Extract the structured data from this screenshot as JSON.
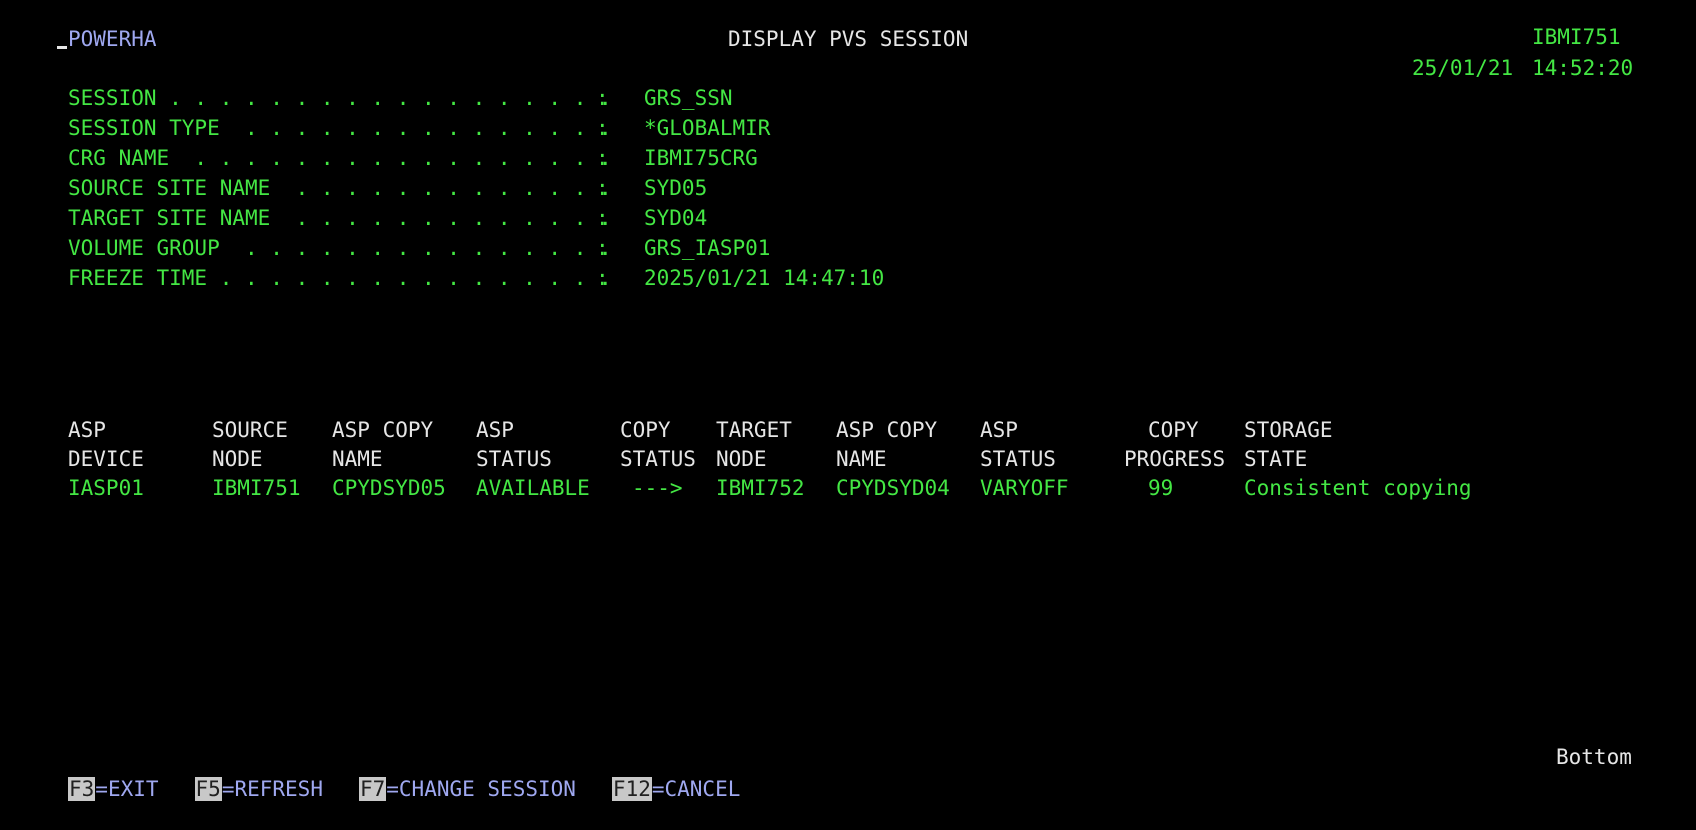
{
  "header": {
    "product": "POWERHA",
    "title": "DISPLAY PVS SESSION",
    "system": "IBMI751",
    "date": "25/01/21",
    "time": "14:52:20"
  },
  "fields": [
    {
      "label": "SESSION . . . . . . . . . . . . . . . . . .",
      "colon": ":",
      "value": "GRS_SSN"
    },
    {
      "label": "SESSION TYPE  . . . . . . . . . . . . . . .",
      "colon": ":",
      "value": "*GLOBALMIR"
    },
    {
      "label": "CRG NAME  . . . . . . . . . . . . . . . . .",
      "colon": ":",
      "value": "IBMI75CRG"
    },
    {
      "label": "SOURCE SITE NAME  . . . . . . . . . . . . .",
      "colon": ":",
      "value": "SYD05"
    },
    {
      "label": "TARGET SITE NAME  . . . . . . . . . . . . .",
      "colon": ":",
      "value": "SYD04"
    },
    {
      "label": "VOLUME GROUP  . . . . . . . . . . . . . . .",
      "colon": ":",
      "value": "GRS_IASP01"
    },
    {
      "label": "FREEZE TIME . . . . . . . . . . . . . . . .",
      "colon": ":",
      "value": "2025/01/21 14:47:10"
    }
  ],
  "table": {
    "headers_row1": [
      "ASP",
      "SOURCE",
      "ASP COPY",
      "ASP",
      "COPY",
      "TARGET",
      "ASP COPY",
      "ASP",
      "COPY",
      "STORAGE"
    ],
    "headers_row2": [
      "DEVICE",
      "NODE",
      "NAME",
      "STATUS",
      "STATUS",
      "NODE",
      "NAME",
      "STATUS",
      "PROGRESS",
      "STATE"
    ],
    "rows": [
      [
        "IASP01",
        "IBMI751",
        "CPYDSYD05",
        "AVAILABLE",
        "--->",
        "IBMI752",
        "CPYDSYD04",
        "VARYOFF",
        "99",
        "Consistent copying"
      ]
    ]
  },
  "bottom_label": "Bottom",
  "function_keys": [
    {
      "key": "F3",
      "label": "=EXIT"
    },
    {
      "key": "F5",
      "label": "=REFRESH"
    },
    {
      "key": "F7",
      "label": "=CHANGE SESSION"
    },
    {
      "key": "F12",
      "label": "=CANCEL"
    }
  ],
  "colors": {
    "background": "#000000",
    "field_text": "#44e744",
    "header_text": "#e6e6e6",
    "fkey_text": "#9fa8f0"
  }
}
